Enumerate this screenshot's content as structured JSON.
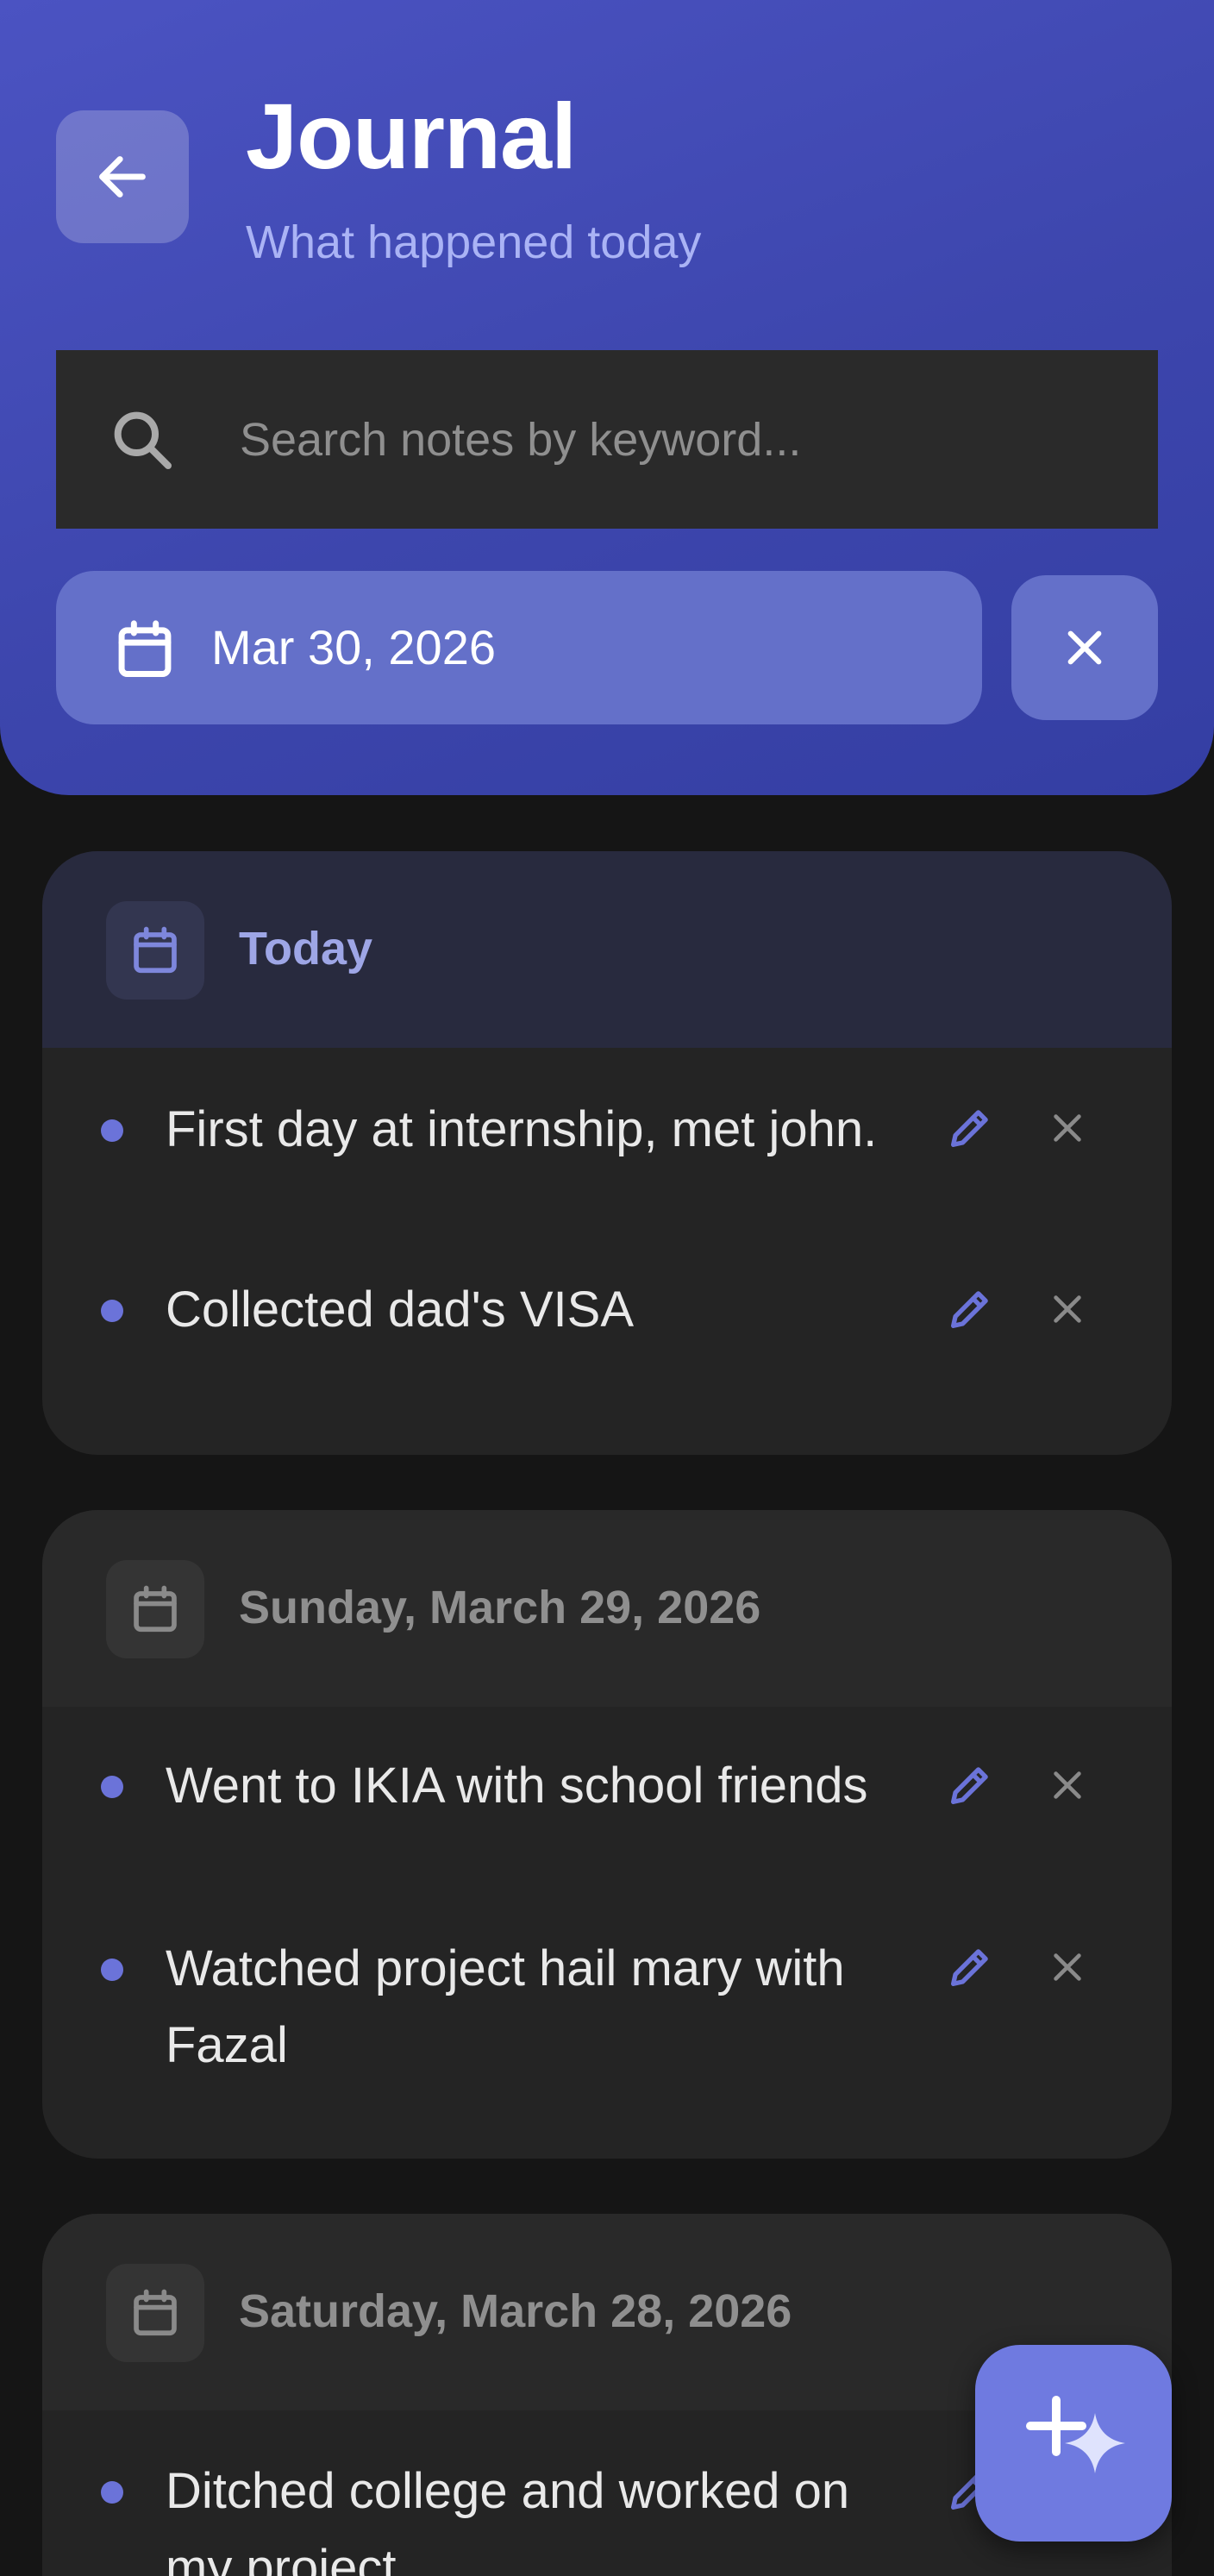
{
  "header": {
    "title": "Journal",
    "subtitle": "What happened today",
    "search_placeholder": "Search notes by keyword...",
    "date_filter": "Mar 30, 2026"
  },
  "days": [
    {
      "title": "Today",
      "entries": [
        "First day at internship, met john.",
        "Collected dad's VISA"
      ]
    },
    {
      "title": "Sunday, March 29, 2026",
      "entries": [
        "Went to IKIA with school friends",
        "Watched project hail mary with Fazal"
      ]
    },
    {
      "title": "Saturday, March 28, 2026",
      "entries": [
        "Ditched college and worked on my project"
      ]
    }
  ],
  "icons": {
    "back": "arrow-left-icon",
    "search": "search-icon",
    "calendar": "calendar-icon",
    "clear": "close-icon",
    "edit": "pencil-icon",
    "delete": "close-icon",
    "fab": "plus-sparkle-icon"
  },
  "colors": {
    "accent": "#4b53c2",
    "accent_light": "#6470c9",
    "bullet": "#6b73d9",
    "background": "#151515",
    "card": "#242424",
    "fab": "#6f7ae0"
  }
}
